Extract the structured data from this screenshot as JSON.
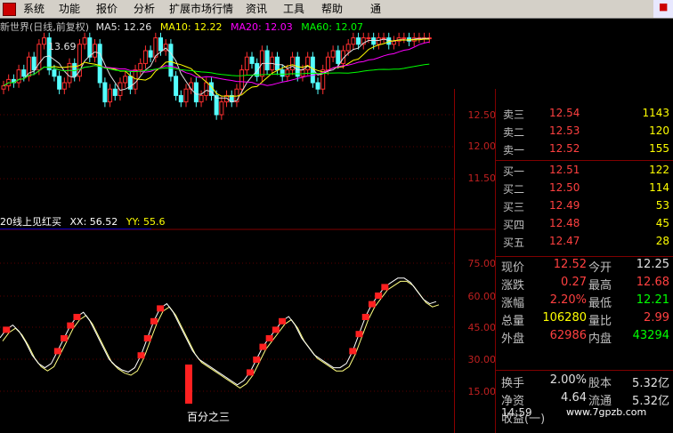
{
  "menu": {
    "items": [
      "系统",
      "功能",
      "报价",
      "分析",
      "扩展市场行情",
      "资讯",
      "工具",
      "帮助"
    ],
    "right_label": "通"
  },
  "title": {
    "name": "新世界(日线,前复权)",
    "ma5": "MA5: 12.26",
    "ma10": "MA10: 12.22",
    "ma20": "MA20: 12.03",
    "ma60": "MA60: 12.07"
  },
  "high_label": "13.69",
  "indicator": {
    "name": "20线上见红买",
    "xx": "XX: 56.52",
    "yy": "YY: 55.6"
  },
  "price_axis": [
    "12.50",
    "12.00",
    "11.50"
  ],
  "ind_axis": [
    "75.00",
    "60.00",
    "45.00",
    "30.00",
    "15.00"
  ],
  "annotation": "百分之三",
  "order_book": [
    {
      "label": "卖三",
      "price": "12.54",
      "vol": "1143"
    },
    {
      "label": "卖二",
      "price": "12.53",
      "vol": "120"
    },
    {
      "label": "卖一",
      "price": "12.52",
      "vol": "155"
    },
    {
      "label": "买一",
      "price": "12.51",
      "vol": "122"
    },
    {
      "label": "买二",
      "price": "12.50",
      "vol": "114"
    },
    {
      "label": "买三",
      "price": "12.49",
      "vol": "53"
    },
    {
      "label": "买四",
      "price": "12.48",
      "vol": "45"
    },
    {
      "label": "买五",
      "price": "12.47",
      "vol": "28"
    }
  ],
  "quotes": [
    {
      "l1": "现价",
      "v1": "12.52",
      "c1": "#ff4040",
      "l2": "今开",
      "v2": "12.25",
      "c2": "#e0e0e0"
    },
    {
      "l1": "涨跌",
      "v1": "0.27",
      "c1": "#ff4040",
      "l2": "最高",
      "v2": "12.68",
      "c2": "#ff4040"
    },
    {
      "l1": "涨幅",
      "v1": "2.20%",
      "c1": "#ff4040",
      "l2": "最低",
      "v2": "12.21",
      "c2": "#00ff00"
    },
    {
      "l1": "总量",
      "v1": "106280",
      "c1": "#ffff00",
      "l2": "量比",
      "v2": "2.99",
      "c2": "#ff4040"
    },
    {
      "l1": "外盘",
      "v1": "62986",
      "c1": "#ff4040",
      "l2": "内盘",
      "v2": "43294",
      "c2": "#00ff00"
    },
    {
      "l1": "换手",
      "v1": "2.00%",
      "c1": "#e0e0e0",
      "l2": "股本",
      "v2": "5.32亿",
      "c2": "#e0e0e0"
    },
    {
      "l1": "净资",
      "v1": "4.64",
      "c1": "#e0e0e0",
      "l2": "流通",
      "v2": "5.32亿",
      "c2": "#e0e0e0"
    },
    {
      "l1": "收益(一)",
      "v1": "",
      "c1": "#e0e0e0",
      "l2": "",
      "v2": "",
      "c2": "#e0e0e0"
    }
  ],
  "time": "14:59",
  "watermark": "www.7gpzb.com",
  "colors": {
    "up": "#ff3030",
    "down": "#54ffff",
    "ma5": "#e0e0e0",
    "ma10": "#ffff00",
    "ma20": "#ff00ff",
    "ma60": "#00ff00"
  }
}
